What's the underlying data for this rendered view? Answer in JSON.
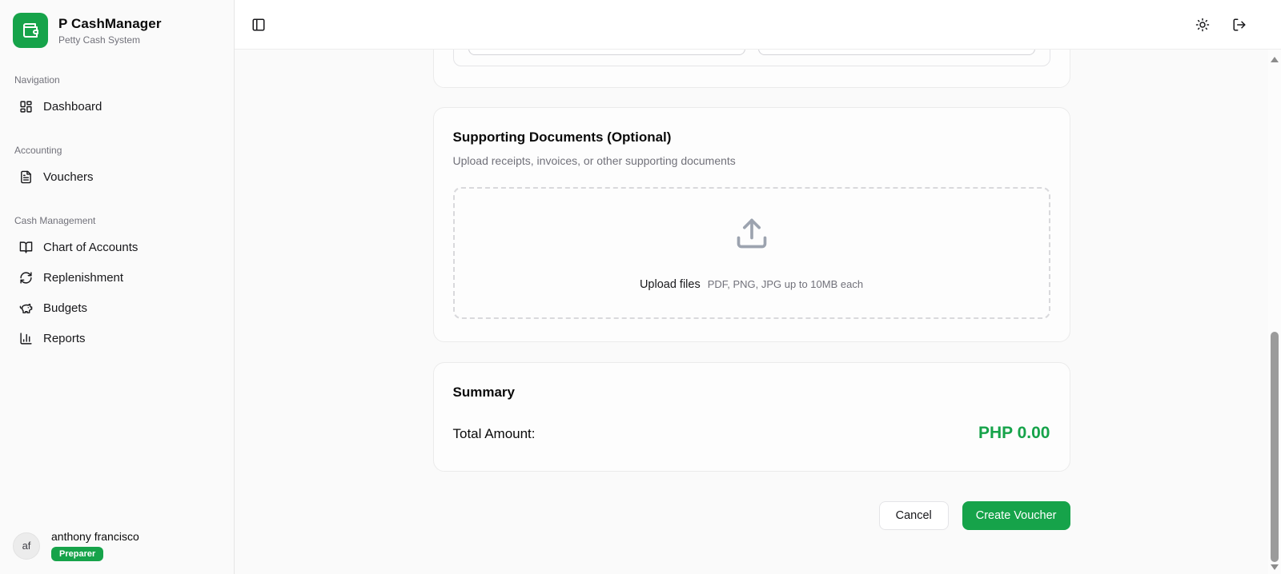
{
  "sidebar": {
    "brand": {
      "title": "P CashManager",
      "subtitle": "Petty Cash System",
      "logo_icon": "wallet-icon",
      "logo_color": "#16a34a"
    },
    "sections": [
      {
        "label": "Navigation",
        "items": [
          {
            "label": "Dashboard",
            "icon": "dashboard-icon"
          }
        ]
      },
      {
        "label": "Accounting",
        "items": [
          {
            "label": "Vouchers",
            "icon": "file-text-icon"
          }
        ]
      },
      {
        "label": "Cash Management",
        "items": [
          {
            "label": "Chart of Accounts",
            "icon": "book-open-icon"
          },
          {
            "label": "Replenishment",
            "icon": "refresh-icon"
          },
          {
            "label": "Budgets",
            "icon": "piggy-bank-icon"
          },
          {
            "label": "Reports",
            "icon": "bar-chart-icon"
          }
        ]
      }
    ],
    "user": {
      "initials": "af",
      "name": "anthony francisco",
      "role_badge": "Preparer",
      "badge_color": "#16a34a"
    }
  },
  "topbar": {
    "icons": [
      "panel-left-icon",
      "sun-icon",
      "logout-icon"
    ]
  },
  "form": {
    "supporting_documents": {
      "title": "Supporting Documents (Optional)",
      "subtitle": "Upload receipts, invoices, or other supporting documents",
      "upload_label": "Upload files",
      "upload_hint": "PDF, PNG, JPG up to 10MB each"
    },
    "summary": {
      "title": "Summary",
      "total_label": "Total Amount:",
      "total_value": "PHP 0.00",
      "total_color": "#16a34a"
    },
    "actions": {
      "cancel": "Cancel",
      "submit": "Create Voucher"
    },
    "line_item_inputs": [
      {
        "value": ""
      },
      {
        "value": ""
      }
    ]
  }
}
